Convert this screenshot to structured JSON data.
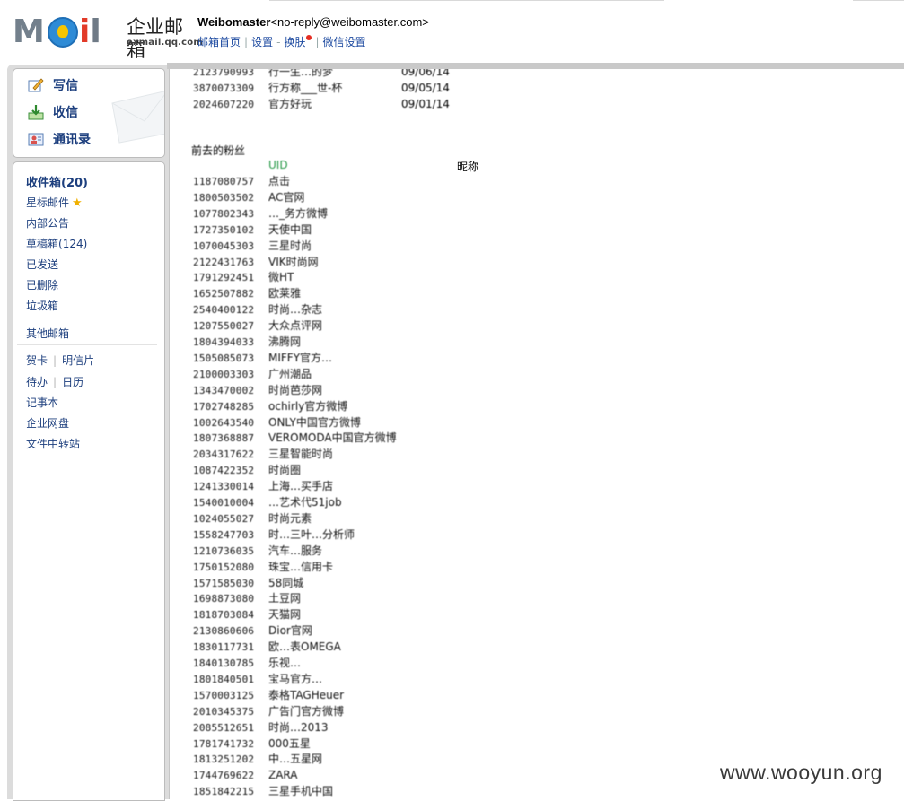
{
  "header": {
    "logo_word": "MOil",
    "logo_cn": "企业邮箱",
    "logo_url": "exmail.qq.com",
    "sender_name": "Weibomaster",
    "sender_email": "<no-reply@weibomaster.com>",
    "links": [
      "邮箱首页",
      "设置",
      "换肤",
      "微信设置"
    ]
  },
  "quick_actions": [
    {
      "label": "写信",
      "icon": "compose-icon"
    },
    {
      "label": "收信",
      "icon": "receive-icon"
    },
    {
      "label": "通讯录",
      "icon": "contacts-icon"
    }
  ],
  "folders": {
    "inbox": "收件箱(20)",
    "starred": "星标邮件",
    "notice": "内部公告",
    "drafts": "草稿箱",
    "drafts_count": "(124)",
    "sent": "已发送",
    "deleted": "已删除",
    "trash": "垃圾箱",
    "other": "其他邮箱",
    "greeting_card": "贺卡",
    "postcard": "明信片",
    "todo": "待办",
    "calendar": "日历",
    "notes": "记事本",
    "netdisk": "企业网盘",
    "transfer": "文件中转站"
  },
  "content": {
    "top_rows": [
      {
        "uid": "2123790993",
        "nick": "行一生…的梦",
        "date": "09/06/14"
      },
      {
        "uid": "3870073309",
        "nick": "行方称___世-杯",
        "date": "09/05/14"
      },
      {
        "uid": "2024607220",
        "nick": "官方好玩",
        "date": "09/01/14"
      }
    ],
    "section_title": "前去的粉丝",
    "col_uid": "UID",
    "col_nick": "昵称",
    "rows": [
      {
        "uid": "1187080757",
        "nick": "点击"
      },
      {
        "uid": "1800503502",
        "nick": "AC官网"
      },
      {
        "uid": "1077802343",
        "nick": "…_务方微博"
      },
      {
        "uid": "1727350102",
        "nick": "天使中国"
      },
      {
        "uid": "1070045303",
        "nick": "三星时尚"
      },
      {
        "uid": "2122431763",
        "nick": "VIK时尚网"
      },
      {
        "uid": "1791292451",
        "nick": "微HT"
      },
      {
        "uid": "1652507882",
        "nick": "欧莱雅"
      },
      {
        "uid": "2540400122",
        "nick": "时尚…杂志"
      },
      {
        "uid": "1207550027",
        "nick": "大众点评网"
      },
      {
        "uid": "1804394033",
        "nick": "沸腾网"
      },
      {
        "uid": "1505085073",
        "nick": "MIFFY官方…"
      },
      {
        "uid": "2100003303",
        "nick": "广州潮品"
      },
      {
        "uid": "1343470002",
        "nick": "时尚芭莎网"
      },
      {
        "uid": "1702748285",
        "nick": "ochirly官方微博"
      },
      {
        "uid": "1002643540",
        "nick": "ONLY中国官方微博"
      },
      {
        "uid": "1807368887",
        "nick": "VEROMODA中国官方微博"
      },
      {
        "uid": "2034317622",
        "nick": "三星智能时尚"
      },
      {
        "uid": "1087422352",
        "nick": "时尚圈"
      },
      {
        "uid": "1241330014",
        "nick": "上海…买手店"
      },
      {
        "uid": "1540010004",
        "nick": "…艺术代51job"
      },
      {
        "uid": "1024055027",
        "nick": "时尚元素"
      },
      {
        "uid": "1558247703",
        "nick": "时…三叶…分析师"
      },
      {
        "uid": "1210736035",
        "nick": "汽车…服务"
      },
      {
        "uid": "1750152080",
        "nick": "珠宝…信用卡"
      },
      {
        "uid": "1571585030",
        "nick": "58同城"
      },
      {
        "uid": "1698873080",
        "nick": "土豆网"
      },
      {
        "uid": "1818703084",
        "nick": "天猫网"
      },
      {
        "uid": "2130860606",
        "nick": "Dior官网"
      },
      {
        "uid": "1830117731",
        "nick": "欧…表OMEGA"
      },
      {
        "uid": "1840130785",
        "nick": "乐视…"
      },
      {
        "uid": "1801840501",
        "nick": "宝马官方…"
      },
      {
        "uid": "1570003125",
        "nick": "泰格TAGHeuer"
      },
      {
        "uid": "2010345375",
        "nick": "广告门官方微博"
      },
      {
        "uid": "2085512651",
        "nick": "时尚…2013"
      },
      {
        "uid": "1781741732",
        "nick": "000五星"
      },
      {
        "uid": "1813251202",
        "nick": "中…五星网"
      },
      {
        "uid": "1744769622",
        "nick": "ZARA"
      },
      {
        "uid": "1851842215",
        "nick": "三星手机中国"
      }
    ]
  },
  "watermark": "www.wooyun.org"
}
